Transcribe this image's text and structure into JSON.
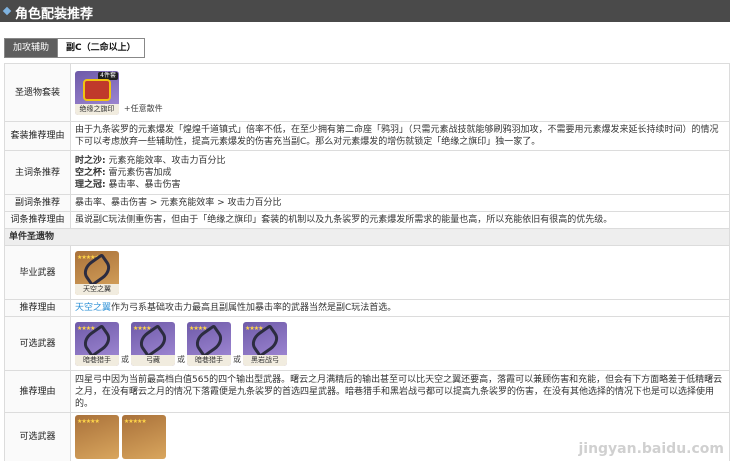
{
  "header": {
    "title": "角色配装推荐"
  },
  "tabs": [
    {
      "label": "加攻辅助",
      "active": true
    },
    {
      "label": "副C（二命以上）",
      "active": false
    }
  ],
  "rows": {
    "artifact_label": "圣遗物套装",
    "artifact_item_name": "绝缘之旗印",
    "artifact_badge": "4件套",
    "artifact_plus": "+任意散件",
    "set_reason_label": "套装推荐理由",
    "set_reason_text": "由于九条裟罗的元素爆发「煌煌千道镇式」倍率不低，在至少拥有第二命座「鸦羽」（只需元素战技就能够刷鸦羽加攻，不需要用元素爆发来延长持续时间）的情况下可以考虑放弃一些辅助性，提高元素爆发的伤害充当副C。那么对元素爆发的增伤就锁定「绝缘之旗印」独一家了。",
    "main_stat_label": "主词条推荐",
    "main_stat_sands_label": "时之沙:",
    "main_stat_sands": "元素充能效率、攻击力百分比",
    "main_stat_goblet_label": "空之杯:",
    "main_stat_goblet": "雷元素伤害加成",
    "main_stat_circlet_label": "理之冠:",
    "main_stat_circlet": "暴击率、暴击伤害",
    "sub_stat_label": "副词条推荐",
    "sub_stat_text": "暴击率、暴击伤害 > 元素充能效率 > 攻击力百分比",
    "sub_reason_label": "词条推荐理由",
    "sub_reason_text": "虽说副C玩法侧重伤害，但由于「绝缘之旗印」套装的机制以及九条裟罗的元素爆发所需求的能量也高，所以充能依旧有很高的优先级。",
    "weapon_section": "单件圣遗物",
    "best_weapon_label": "毕业武器",
    "best_weapon_name": "天空之翼",
    "best_reason_label": "推荐理由",
    "best_reason_link": "天空之翼",
    "best_reason_text": "作为弓系基础攻击力最高且副属性加暴击率的武器当然是副C玩法首选。",
    "alt_weapon_label": "可选武器",
    "alt_weapons": [
      "暗巷猎手",
      "弓藏",
      "暗巷猎手",
      "黑岩战弓"
    ],
    "or_text": "或",
    "alt_reason_label": "推荐理由",
    "alt_reason_text": "四星弓中因为当前最高档白值565的四个输出型武器。曙云之月满精后的输出甚至可以比天空之翼还要高，落霞可以兼顾伤害和充能，但会有下方面略差于低精曙云之月，在没有曙云之月的情况下落霞便是九条裟罗的首选四星武器。暗巷猎手和黑岩战弓都可以提高九条裟罗的伤害，在没有其他选择的情况下也是可以选择使用的。",
    "alt2_label": "可选武器"
  },
  "watermark": "jingyan.baidu.com"
}
